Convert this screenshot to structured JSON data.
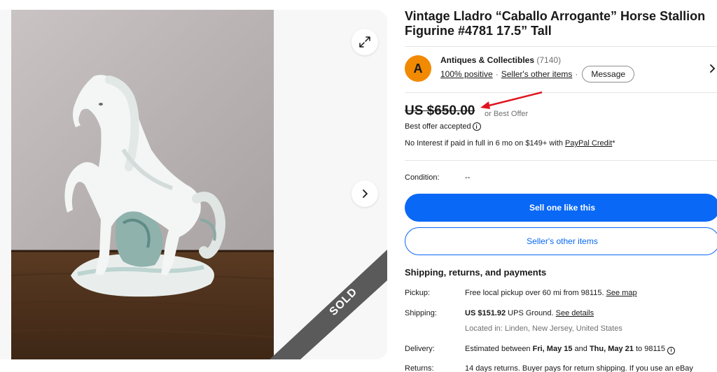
{
  "gallery": {
    "sold_label": "SOLD",
    "expand_icon": "expand-icon",
    "next_icon": "chevron-right-icon"
  },
  "listing": {
    "title": "Vintage Lladro “Caballo Arrogante” Horse Stallion Figurine #4781 17.5” Tall"
  },
  "seller": {
    "avatar_letter": "A",
    "name": "Antiques & Collectibles",
    "feedback_count": "(7140)",
    "positive": "100% positive",
    "other_items": "Seller's other items",
    "message_label": "Message"
  },
  "pricing": {
    "price": "US $650.00",
    "best_offer": "or Best Offer",
    "accepted": "Best offer accepted",
    "financing_prefix": "No Interest if paid in full in 6 mo on $149+ with ",
    "financing_link": "PayPal Credit",
    "financing_suffix": "*"
  },
  "condition": {
    "label": "Condition:",
    "value": "--"
  },
  "actions": {
    "sell_like": "Sell one like this",
    "seller_other": "Seller's other items"
  },
  "shipping": {
    "heading": "Shipping, returns, and payments",
    "pickup_label": "Pickup:",
    "pickup_text": "Free local pickup over 60 mi from 98115. ",
    "pickup_link": "See map",
    "shipping_label": "Shipping:",
    "shipping_price": "US $151.92",
    "shipping_method": " UPS Ground. ",
    "shipping_link": "See details",
    "location": "Located in: Linden, New Jersey, United States",
    "delivery_label": "Delivery:",
    "delivery_prefix": "Estimated between ",
    "delivery_start": "Fri, May 15",
    "delivery_and": " and ",
    "delivery_end": "Thu, May 21",
    "delivery_suffix": " to 98115",
    "returns_label": "Returns:",
    "returns_text": "14 days returns. Buyer pays for return shipping. If you use an eBay"
  },
  "colors": {
    "accent_blue": "#0968f6",
    "avatar_orange": "#f18a00",
    "annotation_red": "#e0141e",
    "sold_ribbon": "#5a5a5a"
  }
}
